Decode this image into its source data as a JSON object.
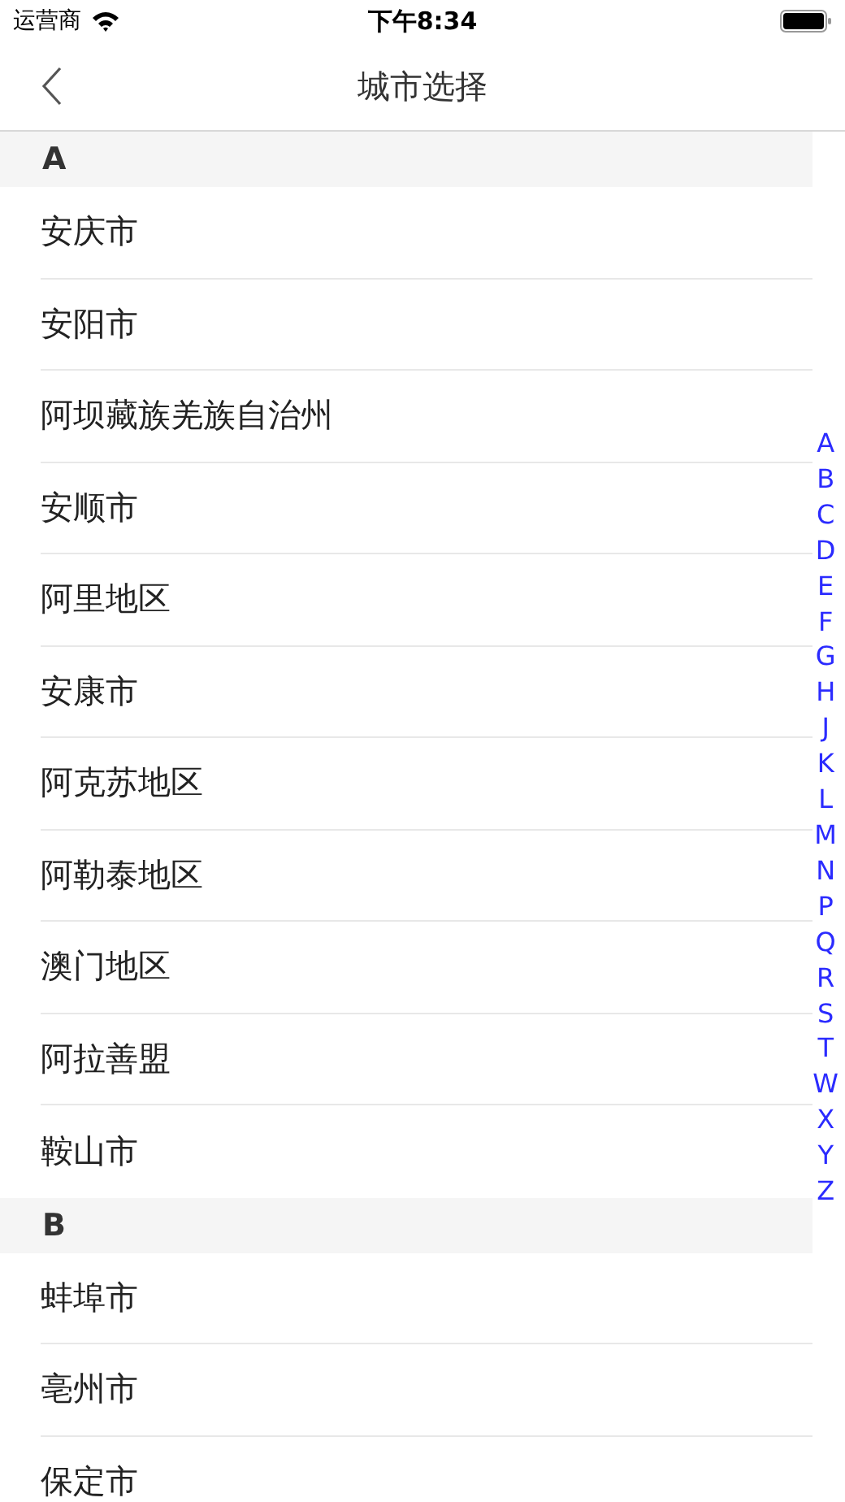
{
  "status_bar": {
    "carrier": "运营商",
    "time": "下午8:34"
  },
  "nav": {
    "title": "城市选择"
  },
  "sections": [
    {
      "letter": "A",
      "cities": [
        "安庆市",
        "安阳市",
        "阿坝藏族羌族自治州",
        "安顺市",
        "阿里地区",
        "安康市",
        "阿克苏地区",
        "阿勒泰地区",
        "澳门地区",
        "阿拉善盟",
        "鞍山市"
      ]
    },
    {
      "letter": "B",
      "cities": [
        "蚌埠市",
        "亳州市",
        "保定市"
      ]
    }
  ],
  "index": [
    "A",
    "B",
    "C",
    "D",
    "E",
    "F",
    "G",
    "H",
    "J",
    "K",
    "L",
    "M",
    "N",
    "P",
    "Q",
    "R",
    "S",
    "T",
    "W",
    "X",
    "Y",
    "Z"
  ]
}
